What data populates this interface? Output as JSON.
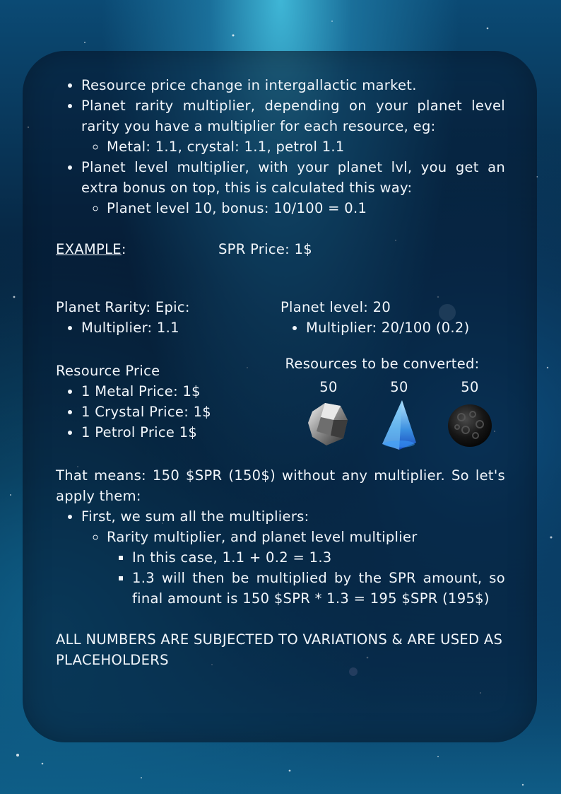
{
  "bullets_top": {
    "item1": "Resource price change in intergallactic market.",
    "item2": "Planet rarity multiplier, depending on your planet level rarity you have a multiplier for each resource, eg:",
    "item2_sub": "Metal: 1.1, crystal: 1.1, petrol 1.1",
    "item3": "Planet level multiplier, with your planet lvl, you get an extra bonus on top, this is calculated this way:",
    "item3_sub": "Planet level 10, bonus: 10/100 = 0.1"
  },
  "example": {
    "label": "EXAMPLE",
    "colon": ":",
    "spr_price": "SPR Price: 1$"
  },
  "rarity": {
    "title": "Planet Rarity: Epic:",
    "multiplier": "Multiplier: 1.1"
  },
  "level": {
    "title": "Planet level: 20",
    "multiplier": "Multiplier: 20/100 (0.2)"
  },
  "resource_price": {
    "title": "Resource Price",
    "items": [
      "1 Metal Price: 1$",
      "1 Crystal Price: 1$",
      "1 Petrol Price 1$"
    ]
  },
  "conversion": {
    "title": "Resources to be converted:",
    "resources": [
      {
        "amount": "50",
        "icon": "metal-icon"
      },
      {
        "amount": "50",
        "icon": "crystal-icon"
      },
      {
        "amount": "50",
        "icon": "petrol-icon"
      }
    ]
  },
  "explanation": {
    "intro": "That means: 150 $SPR (150$) without any multiplier. So let's apply them:",
    "step1": "First, we sum all the multipliers:",
    "step1_sub": "Rarity multiplier, and planet level multiplier",
    "step1_sub_a": "In this case, 1.1 + 0.2 = 1.3",
    "step1_sub_b": "1.3 will then be multiplied by the SPR amount, so final amount is 150 $SPR * 1.3 = 195 $SPR (195$)"
  },
  "disclaimer": "ALL NUMBERS ARE SUBJECTED TO VARIATIONS & ARE USED AS PLACEHOLDERS"
}
